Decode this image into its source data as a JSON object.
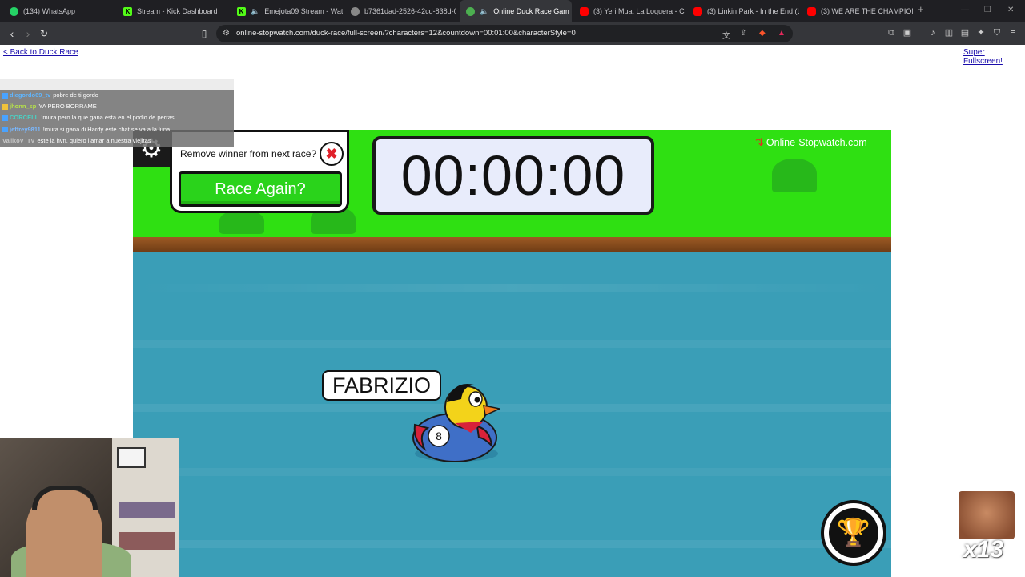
{
  "browser": {
    "tabs": [
      {
        "title": "(134) WhatsApp",
        "icon": "whatsapp-icon",
        "color": "#25d366"
      },
      {
        "title": "Stream - Kick Dashboard",
        "icon": "kick-icon",
        "color": "#53fc18"
      },
      {
        "title": "Emejota09 Stream - Watch",
        "icon": "kick-icon",
        "color": "#53fc18"
      },
      {
        "title": "b7361dad-2526-42cd-838d-0",
        "icon": "globe-icon",
        "color": "#aaaaaa"
      },
      {
        "title": "Online Duck Race Gam",
        "icon": "stopwatch-icon",
        "color": "#4caf50",
        "active": true
      },
      {
        "title": "(3) Yeri Mua, La Loquera - Cro",
        "icon": "youtube-icon",
        "color": "#ff0000"
      },
      {
        "title": "(3) Linkin Park - In the End (Ly",
        "icon": "youtube-icon",
        "color": "#ff0000"
      },
      {
        "title": "(3) WE ARE THE CHAMPION, S",
        "icon": "youtube-icon",
        "color": "#ff0000"
      }
    ],
    "url": "online-stopwatch.com/duck-race/full-screen/?characters=12&countdown=00:01:00&characterStyle=0"
  },
  "page": {
    "back_link": "< Back to Duck Race",
    "fullscreen_link": "Super Fullscreen!"
  },
  "chat": {
    "messages": [
      {
        "user": "diegordo69_tv",
        "text": "pobre de ti gordo"
      },
      {
        "user": "jhonn_sp",
        "text": "YA PERO BORRAME"
      },
      {
        "user": "CORCELL",
        "text": "!mura pero la que gana esta en el podio de perras"
      },
      {
        "user": "jeffrey9811",
        "text": "!mura si gana di Hardy este chat se va a la luna"
      },
      {
        "user": "ValikoV_TV",
        "text": "este la hvn, quiero llamar a nuestra viejitas"
      }
    ]
  },
  "game": {
    "remove_question": "Remove winner from next race?",
    "race_again": "Race Again?",
    "timer": "00:00:00",
    "brand": "Online-Stopwatch.com",
    "duck": {
      "name": "FABRIZIO",
      "number": "8"
    }
  },
  "overlay": {
    "emote_count": "x13"
  },
  "colors": {
    "grass": "#2fe012",
    "water": "#3a9eb7",
    "button": "#2ad31b"
  }
}
